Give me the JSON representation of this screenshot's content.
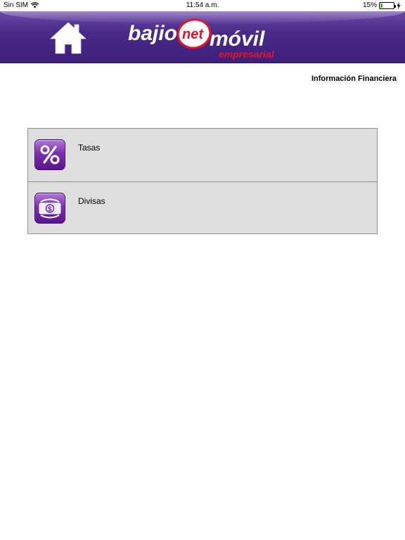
{
  "status_bar": {
    "carrier": "Sin SIM",
    "time": "11:54 a.m.",
    "battery_percent": "15%",
    "battery_level": 0.15
  },
  "header": {
    "logo_primary": "bajio",
    "logo_circle": "net",
    "logo_secondary": "móvil",
    "logo_subtitle": "empresarial",
    "home_icon": "home-icon"
  },
  "page": {
    "title": "Información Financiera"
  },
  "menu": {
    "items": [
      {
        "label": "Tasas",
        "icon": "percent-icon"
      },
      {
        "label": "Divisas",
        "icon": "currency-exchange-icon"
      }
    ]
  },
  "colors": {
    "header_purple": "#4b2a8a",
    "icon_purple": "#7a2fb0",
    "logo_red": "#e2162a",
    "list_background": "#dedede"
  }
}
